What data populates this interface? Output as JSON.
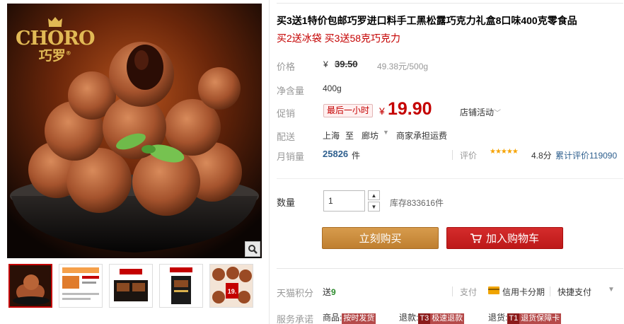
{
  "brand": {
    "name_en": "CHORO",
    "name_cn": "巧罗",
    "registered": "®"
  },
  "product": {
    "title": "买3送1特价包邮巧罗进口料手工黑松露巧克力礼盒8口味400克零食品",
    "subtitle": "买2送冰袋 买3送58克巧克力"
  },
  "price": {
    "label": "价格",
    "currency": "¥",
    "original": "39.50",
    "unit_price": "49.38元/500g"
  },
  "weight": {
    "label": "净含量",
    "value": "400g"
  },
  "promo": {
    "label": "促销",
    "tag": "最后一小时",
    "currency": "¥",
    "price": "19.90",
    "shop_activity": "店铺活动"
  },
  "shipping": {
    "label": "配送",
    "from": "上海",
    "to_word": "至",
    "to_city": "廊坊",
    "fee": "商家承担运费"
  },
  "sales": {
    "label": "月销量",
    "count": "25826",
    "unit": "件",
    "rating_label": "评价",
    "stars": "★★★★★",
    "score": "4.8分",
    "review_text": "累计评价119090"
  },
  "quantity": {
    "label": "数量",
    "value": "1",
    "stock": "库存833616件"
  },
  "buttons": {
    "buy": "立刻购买",
    "cart": "加入购物车"
  },
  "points": {
    "label": "天猫积分",
    "send": "送",
    "value": "9"
  },
  "payment": {
    "label": "支付",
    "credit": "信用卡分期",
    "quick": "快捷支付"
  },
  "service": {
    "label": "服务承诺",
    "items": [
      {
        "prefix": "商品:",
        "tag": "",
        "text": "按时发货"
      },
      {
        "prefix": "退款:",
        "tag": "T3",
        "text": "极速退款"
      },
      {
        "prefix": "退货:",
        "tag": "T1",
        "text": "退货保障卡"
      }
    ]
  },
  "thumb_badge": "19."
}
